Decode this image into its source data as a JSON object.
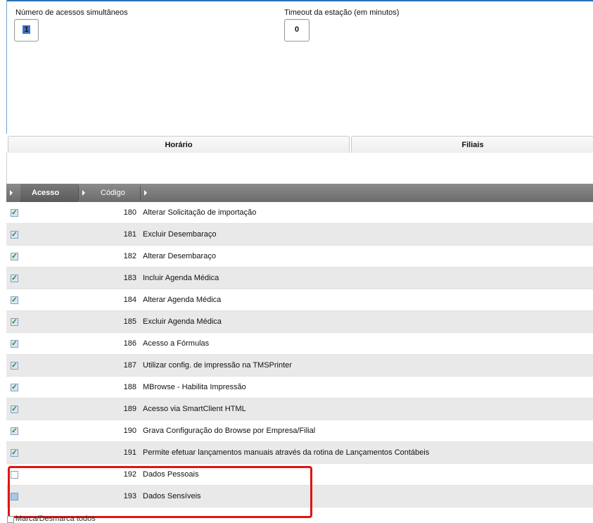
{
  "fields": {
    "simultaneous_label": "Número de acessos simultâneos",
    "simultaneous_value": "1",
    "timeout_label": "Timeout da estação (em minutos)",
    "timeout_value": "0"
  },
  "tabs": [
    {
      "label": "Horário"
    },
    {
      "label": "Filiais"
    }
  ],
  "grid": {
    "columns": [
      "Acesso",
      "Código"
    ],
    "rows": [
      {
        "code": "180",
        "desc": "Alterar Solicitação de importação",
        "checked": true
      },
      {
        "code": "181",
        "desc": "Excluir Desembaraço",
        "checked": true
      },
      {
        "code": "182",
        "desc": "Alterar Desembaraço",
        "checked": true
      },
      {
        "code": "183",
        "desc": "Incluir Agenda Médica",
        "checked": true
      },
      {
        "code": "184",
        "desc": "Alterar Agenda Médica",
        "checked": true
      },
      {
        "code": "185",
        "desc": "Excluir Agenda Médica",
        "checked": true
      },
      {
        "code": "186",
        "desc": "Acesso a Fórmulas",
        "checked": true
      },
      {
        "code": "187",
        "desc": "Utilizar config. de impressão na TMSPrinter",
        "checked": true
      },
      {
        "code": "188",
        "desc": "MBrowse - Habilita Impressão",
        "checked": true
      },
      {
        "code": "189",
        "desc": "Acesso via SmartClient HTML",
        "checked": true
      },
      {
        "code": "190",
        "desc": "Grava Configuração do Browse por Empresa/Filial",
        "checked": true
      },
      {
        "code": "191",
        "desc": "Permite efetuar lançamentos manuais através da rotina de Lançamentos Contábeis",
        "checked": true
      },
      {
        "code": "192",
        "desc": "Dados Pessoais",
        "checked": false
      },
      {
        "code": "193",
        "desc": "Dados Sensíveis",
        "checked": false
      }
    ]
  },
  "footer": {
    "toggle_all_label": "Marca/Desmarca todos"
  },
  "colors": {
    "highlight": "#e01414",
    "header_bg": "#7a7a7a",
    "selection": "#3d6fc4"
  }
}
